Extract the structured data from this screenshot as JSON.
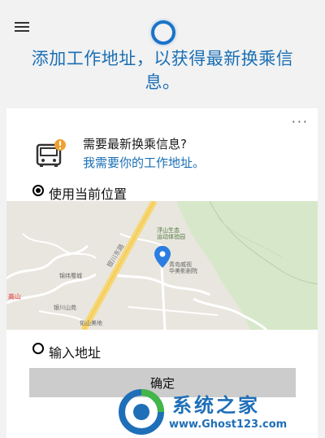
{
  "header": {
    "headline": "添加工作地址，以获得最新换乘信息。"
  },
  "card": {
    "more_label": "···",
    "question_title": "需要最新换乘信息?",
    "question_link": "我需要你的工作地址。",
    "options": [
      {
        "label": "使用当前位置",
        "selected": true
      },
      {
        "label": "输入地址",
        "selected": false
      }
    ],
    "confirm_label": "确定"
  },
  "map": {
    "labels": [
      "浮山生态",
      "运动体验园",
      "青岛威视",
      "华美影剧院",
      "锦纬蜀城",
      "银川山苑",
      "佑山美地",
      "高山"
    ],
    "road_label": "银川东路"
  },
  "watermark": {
    "title": "系统之家",
    "url": "www.Ghost123.com"
  },
  "colors": {
    "accent": "#1a6fb5",
    "background": "#f2f2f2",
    "card": "#ffffff",
    "button": "#cccccc"
  }
}
